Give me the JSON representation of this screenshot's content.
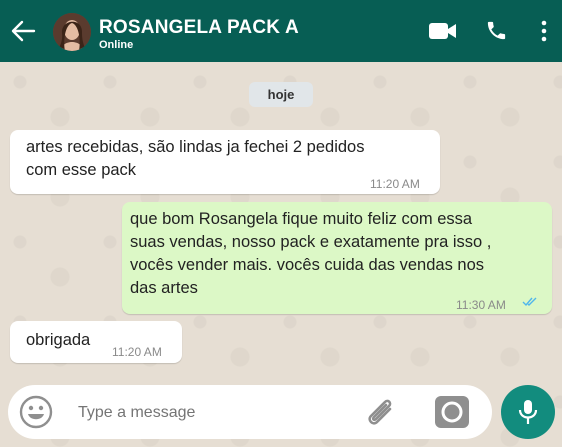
{
  "header": {
    "contact_name": "ROSANGELA PACK A",
    "status": "Online",
    "icons": [
      "back-arrow-icon",
      "avatar",
      "video-call-icon",
      "phone-icon",
      "menu-dots-icon"
    ],
    "color": "#075e54"
  },
  "chat": {
    "day_label": "hoje",
    "messages": [
      {
        "direction": "incoming",
        "lines": [
          "artes recebidas, são lindas ja fechei 2 pedidos",
          "com esse pack"
        ],
        "time": "11:20 AM"
      },
      {
        "direction": "outgoing",
        "lines": [
          "que bom Rosangela fique muito feliz com essa",
          "suas vendas, nosso pack e exatamente pra isso ,",
          "vocês vender mais. vocês cuida das vendas nos",
          "das artes"
        ],
        "time": "11:30 AM",
        "read_ticks": "double-check-blue"
      },
      {
        "direction": "incoming",
        "lines": [
          "obrigada"
        ],
        "time": "11:20 AM"
      }
    ]
  },
  "composer": {
    "placeholder": "Type a message",
    "icons": [
      "emoji-icon",
      "attach-icon",
      "camera-icon",
      "mic-icon"
    ]
  },
  "colors": {
    "outgoing_bubble": "#dcf8c6",
    "incoming_bubble": "#ffffff",
    "accent": "#128c7e",
    "tick_blue": "#4fb6ec"
  }
}
